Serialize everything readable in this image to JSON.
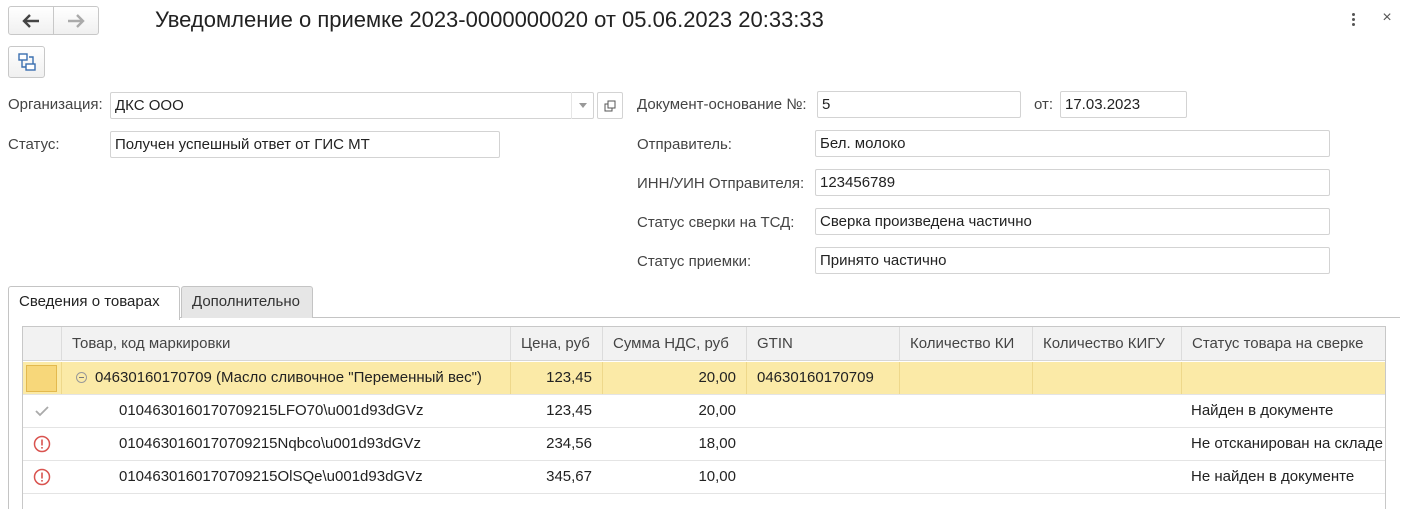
{
  "header": {
    "title": "Уведомление о приемке 2023-0000000020 от 05.06.2023 20:33:33",
    "back_icon": "arrow-left-icon",
    "forward_icon": "arrow-right-icon",
    "more_icon": "kebab-menu-icon",
    "close_glyph": "×"
  },
  "toolbar": {
    "structure_icon": "document-structure-icon"
  },
  "form": {
    "organization": {
      "label": "Организация:",
      "value": "ДКС ООО"
    },
    "status": {
      "label": "Статус:",
      "value": "Получен успешный ответ от ГИС МТ"
    },
    "base_doc": {
      "label": "Документ-основание №:",
      "value": "5",
      "date_label": "от:",
      "date_value": "17.03.2023"
    },
    "sender": {
      "label": "Отправитель:",
      "value": "Бел. молоко"
    },
    "sender_inn": {
      "label": "ИНН/УИН Отправителя:",
      "value": "123456789"
    },
    "tsd_status": {
      "label": "Статус сверки на ТСД:",
      "value": "Сверка произведена частично"
    },
    "acceptance_status": {
      "label": "Статус приемки:",
      "value": "Принято частично"
    }
  },
  "tabs": [
    {
      "label": "Сведения о товарах",
      "active": true
    },
    {
      "label": "Дополнительно",
      "active": false
    }
  ],
  "table": {
    "columns": [
      "Товар, код маркировки",
      "Цена, руб",
      "Сумма НДС, руб",
      "GTIN",
      "Количество КИ",
      "Количество КИГУ",
      "Статус товара на сверке"
    ],
    "rows": [
      {
        "icon": "",
        "product": "04630160170709 (Масло сливочное \"Переменный вес\")",
        "price": "123,45",
        "vat": "20,00",
        "gtin": "04630160170709",
        "qty_ki": "",
        "qty_kigu": "",
        "status": "",
        "selected": true,
        "group": true
      },
      {
        "icon": "checkmark-icon",
        "product": "0104630160170709215LFO70\\u001d93dGVz",
        "price": "123,45",
        "vat": "20,00",
        "gtin": "",
        "qty_ki": "",
        "qty_kigu": "",
        "status": "Найден в документе"
      },
      {
        "icon": "warning-circle-icon",
        "product": "0104630160170709215Nqbco\\u001d93dGVz",
        "price": "234,56",
        "vat": "18,00",
        "gtin": "",
        "qty_ki": "",
        "qty_kigu": "",
        "status": "Не отсканирован на складе"
      },
      {
        "icon": "warning-circle-icon",
        "product": "0104630160170709215OlSQe\\u001d93dGVz",
        "price": "345,67",
        "vat": "10,00",
        "gtin": "",
        "qty_ki": "",
        "qty_kigu": "",
        "status": "Не найден в документе"
      }
    ]
  },
  "colors": {
    "selected_row": "#fbeaa7",
    "warning": "#d9534f",
    "check": "#aaaaaa"
  }
}
